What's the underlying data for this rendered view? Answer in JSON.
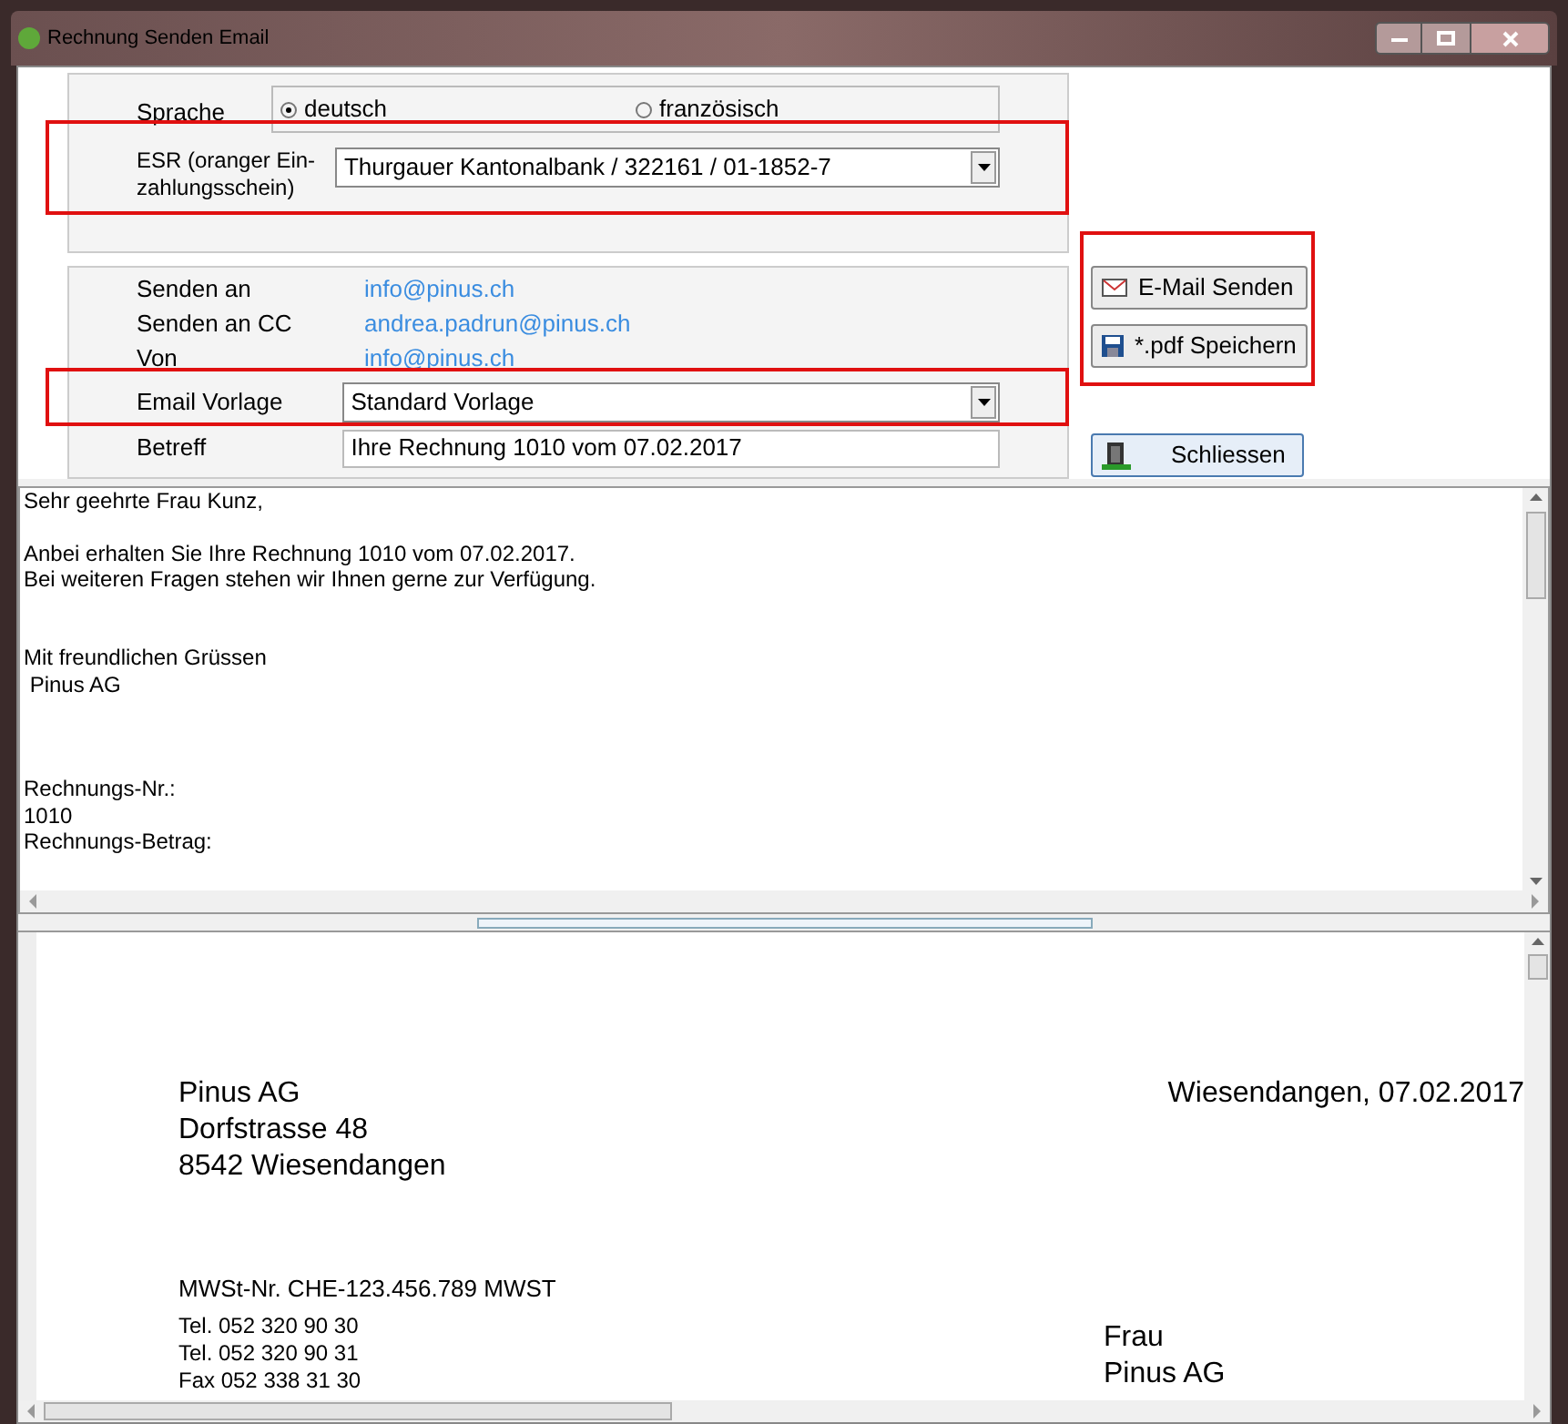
{
  "window": {
    "title": "Rechnung Senden Email"
  },
  "language": {
    "label": "Sprache",
    "options": [
      {
        "label": "deutsch",
        "selected": true
      },
      {
        "label": "französisch",
        "selected": false
      }
    ]
  },
  "esr": {
    "label": "ESR (oranger Ein-zahlungsschein)",
    "value": "Thurgauer Kantonalbank / 322161 / 01-1852-7"
  },
  "recipients": [
    {
      "label": "Senden an",
      "value": "info@pinus.ch"
    },
    {
      "label": "Senden an CC",
      "value": "andrea.padrun@pinus.ch"
    },
    {
      "label": "Von",
      "value": "info@pinus.ch"
    }
  ],
  "template": {
    "label": "Email Vorlage",
    "value": "Standard Vorlage"
  },
  "subject": {
    "label": "Betreff",
    "value": "Ihre Rechnung 1010 vom 07.02.2017"
  },
  "buttons": [
    {
      "kind": "mail",
      "label": "E-Mail Senden"
    },
    {
      "kind": "save",
      "label": "*.pdf Speichern"
    },
    {
      "kind": "close",
      "label": "Schliessen"
    }
  ],
  "body_text": "Sehr geehrte Frau Kunz,\n\nAnbei erhalten Sie Ihre Rechnung 1010 vom 07.02.2017.\nBei weiteren Fragen stehen wir Ihnen gerne zur Verfügung.\n\n\nMit freundlichen Grüssen\n Pinus AG\n\n\n\nRechnungs-Nr.:\n1010\nRechnungs-Betrag:",
  "preview": {
    "sender": [
      "Pinus AG",
      "Dorfstrasse 48",
      "8542 Wiesendangen"
    ],
    "place_date": "Wiesendangen, 07.02.2017",
    "vat": "MWSt-Nr. CHE-123.456.789 MWST",
    "contacts": [
      "Tel. 052 320 90 30",
      "Tel. 052 320 90 31",
      "Fax 052 338 31 30"
    ],
    "recipient": [
      "Frau",
      "Pinus AG"
    ]
  }
}
